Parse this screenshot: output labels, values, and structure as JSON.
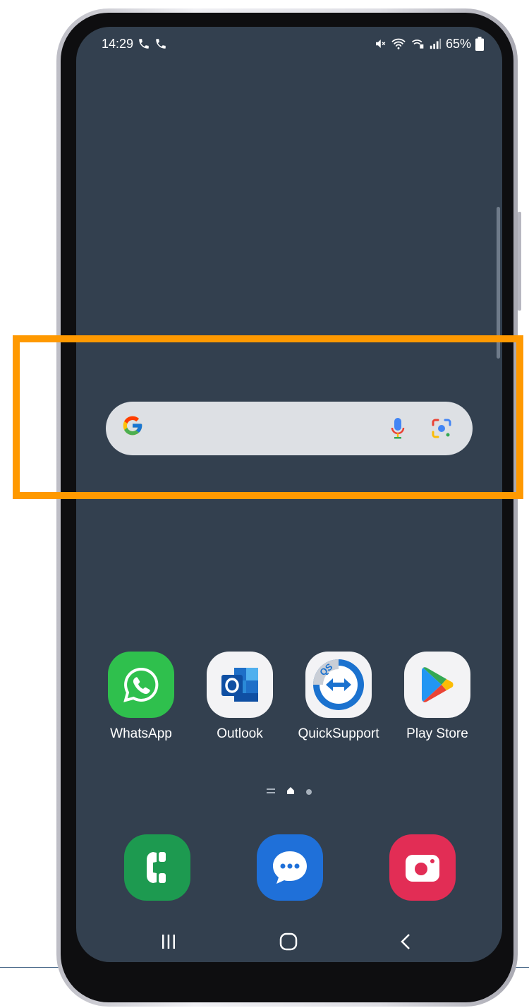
{
  "status_bar": {
    "time": "14:29",
    "battery": "65%",
    "left_icons": [
      "phone-call-icon",
      "phone-call-icon"
    ],
    "right_icons": [
      "mute-icon",
      "wifi-call-icon",
      "volte-icon",
      "signal-icon",
      "battery-icon"
    ]
  },
  "search_widget": {
    "logo": "G",
    "placeholder": "",
    "icons": [
      "google-logo",
      "mic-icon",
      "lens-icon"
    ]
  },
  "apps": [
    {
      "label": "WhatsApp",
      "icon": "whatsapp-icon"
    },
    {
      "label": "Outlook",
      "icon": "outlook-icon"
    },
    {
      "label": "QuickSupport",
      "icon": "quicksupport-icon"
    },
    {
      "label": "Play Store",
      "icon": "play-store-icon"
    }
  ],
  "dock": [
    {
      "icon": "phone-app-icon"
    },
    {
      "icon": "messages-app-icon"
    },
    {
      "icon": "camera-app-icon"
    }
  ],
  "page_indicator": {
    "pages": 2,
    "current": 1
  },
  "nav_bar": {
    "buttons": [
      "recents-icon",
      "home-icon",
      "back-icon"
    ]
  },
  "colors": {
    "wallpaper": "#33404f",
    "highlight": "#ff9900",
    "search_bar": "#dde0e4",
    "whatsapp": "#2fc04d",
    "phone": "#1d9a50",
    "messages": "#1f70d9",
    "camera": "#e22d55"
  }
}
